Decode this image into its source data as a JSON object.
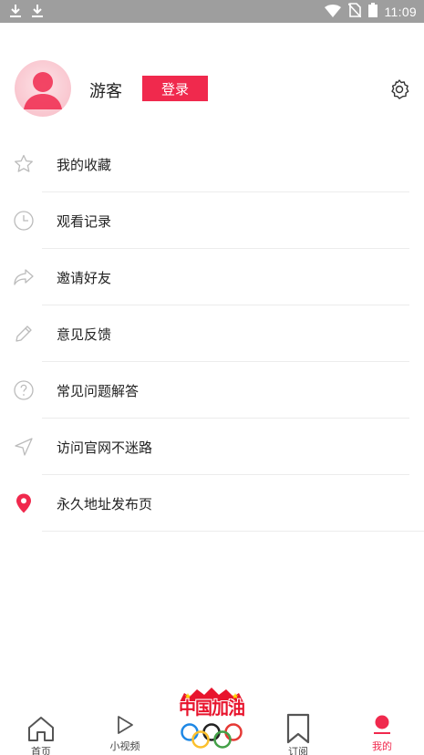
{
  "status_bar": {
    "time": "11:09",
    "left_icons": [
      "download-icon",
      "download-icon"
    ],
    "right_icons": [
      "wifi-icon",
      "no-sim-icon",
      "battery-icon"
    ]
  },
  "profile": {
    "username": "游客",
    "login_label": "登录",
    "accent_color": "#f0294d"
  },
  "menu": {
    "items": [
      {
        "label": "我的收藏",
        "icon": "star-icon"
      },
      {
        "label": "观看记录",
        "icon": "clock-icon"
      },
      {
        "label": "邀请好友",
        "icon": "share-icon"
      },
      {
        "label": "意见反馈",
        "icon": "pencil-icon"
      },
      {
        "label": "常见问题解答",
        "icon": "question-icon"
      },
      {
        "label": "访问官网不迷路",
        "icon": "navigation-icon"
      },
      {
        "label": "永久地址发布页",
        "icon": "location-pin-icon"
      }
    ]
  },
  "bottom_nav": {
    "items": [
      {
        "label": "首页",
        "icon": "home-icon"
      },
      {
        "label": "小视频",
        "icon": "play-icon"
      },
      {
        "label": "订阅",
        "icon": "bookmark-icon"
      },
      {
        "label": "我的",
        "icon": "user-icon",
        "active": true
      }
    ],
    "center_promo": {
      "text": "中国加油",
      "icon": "olympic-rings-icon"
    }
  }
}
